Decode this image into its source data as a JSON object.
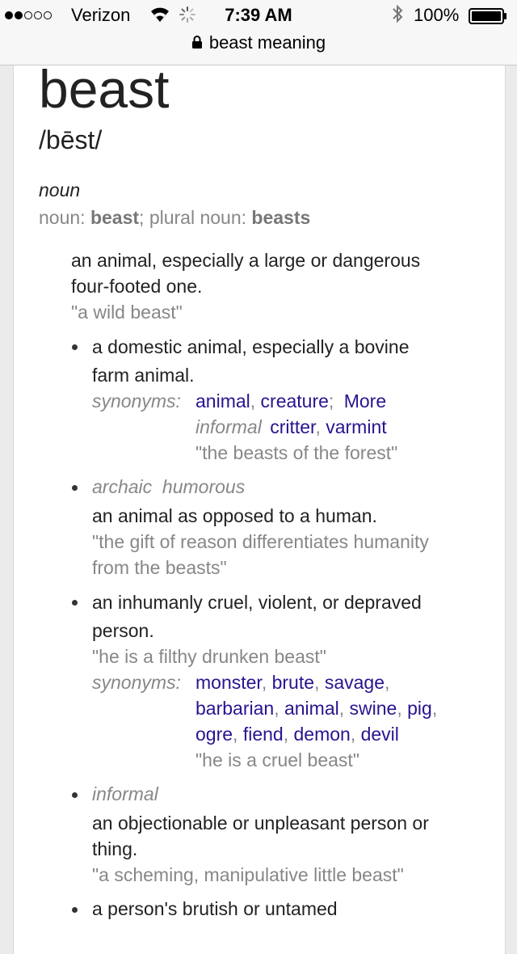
{
  "status_bar": {
    "carrier": "Verizon",
    "time": "7:39 AM",
    "battery": "100%"
  },
  "url_bar": {
    "query": "beast meaning"
  },
  "entry": {
    "headword": "beast",
    "phonetic": "/bēst/",
    "part_of_speech": "noun",
    "forms": {
      "noun_label": "noun:",
      "noun": "beast",
      "sep": ";",
      "plural_label": "plural noun:",
      "plural": "beasts"
    },
    "main_def": {
      "text_line1": "an animal, especially a large or dangerous",
      "text_line2": "four-footed one.",
      "example": "\"a wild beast\""
    },
    "senses": [
      {
        "def_line1": "a domestic animal, especially a bovine",
        "def_line2": "farm animal.",
        "synonyms_label": "synonyms:",
        "synonyms": [
          "animal",
          "creature"
        ],
        "more_link": "More",
        "informal_label": "informal",
        "informal_synonyms": [
          "critter",
          "varmint"
        ],
        "example": "\"the beasts of the forest\""
      },
      {
        "labels": "archaic  humorous",
        "def": "an animal as opposed to a human.",
        "example_line1": "\"the gift of reason differentiates humanity",
        "example_line2": "from the beasts\""
      },
      {
        "def_line1": "an inhumanly cruel, violent, or depraved",
        "def_line2": "person.",
        "example": "\"he is a filthy drunken beast\"",
        "synonyms_label": "synonyms:",
        "synonyms_row1": [
          "monster",
          "brute",
          "savage"
        ],
        "synonyms_row2": [
          "barbarian",
          "animal",
          "swine",
          "pig"
        ],
        "synonyms_row3": [
          "ogre",
          "fiend",
          "demon",
          "devil"
        ],
        "synonyms_example": "\"he is a cruel beast\""
      },
      {
        "labels": "informal",
        "def_line1": "an objectionable or unpleasant person or",
        "def_line2": "thing.",
        "example": "\"a scheming, manipulative little beast\""
      },
      {
        "def_line1": "a person's brutish or untamed"
      }
    ]
  }
}
